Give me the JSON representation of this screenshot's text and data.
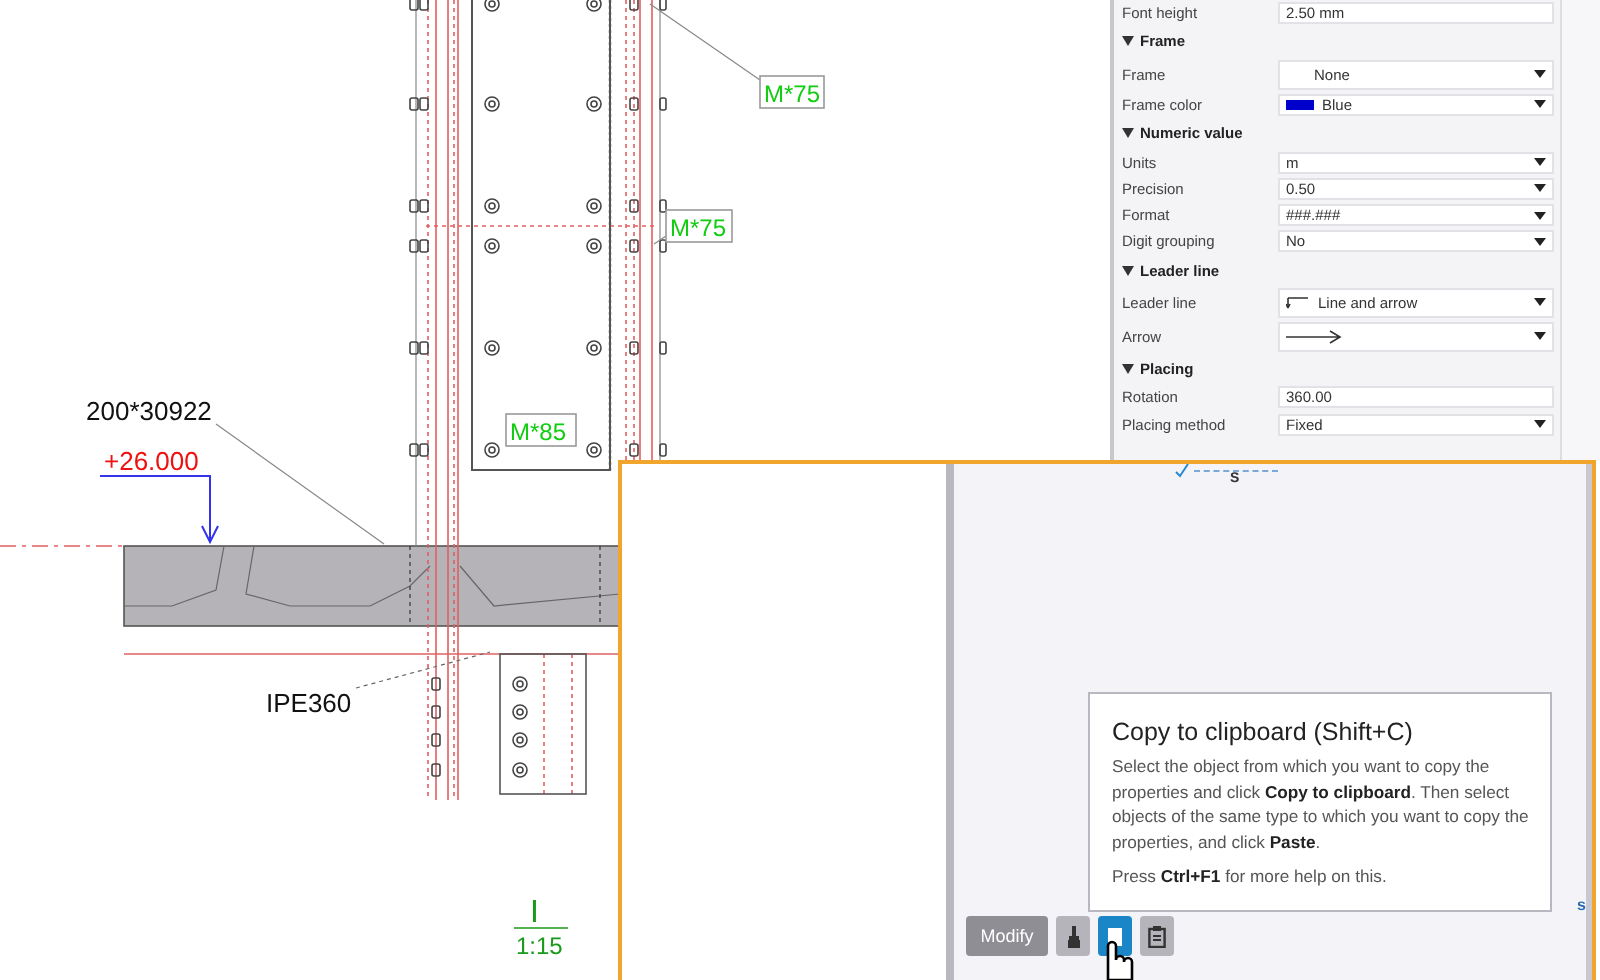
{
  "drawing": {
    "bolt_tags": [
      "M*75",
      "M*75",
      "M*85"
    ],
    "plate_label": "200*30922",
    "elevation": "+26.000",
    "profile_label": "IPE360",
    "detail_mark": "I",
    "scale": "1:15"
  },
  "properties": {
    "top_rows": [
      {
        "label": "Font height",
        "value": "2.50 mm",
        "kind": "input"
      }
    ],
    "sections": [
      {
        "title": "Frame",
        "expanded": true,
        "rows": [
          {
            "label": "Frame",
            "value": "None",
            "kind": "dropdown"
          },
          {
            "label": "Frame color",
            "value": "Blue",
            "kind": "color",
            "color": "#0000cc"
          }
        ]
      },
      {
        "title": "Numeric value",
        "expanded": true,
        "rows": [
          {
            "label": "Units",
            "value": "m",
            "kind": "dropdown"
          },
          {
            "label": "Precision",
            "value": "0.50",
            "kind": "dropdown"
          },
          {
            "label": "Format",
            "value": "###.###",
            "kind": "dropdown"
          },
          {
            "label": "Digit grouping",
            "value": "No",
            "kind": "dropdown"
          }
        ]
      },
      {
        "title": "Leader line",
        "expanded": true,
        "rows": [
          {
            "label": "Leader line",
            "value": "Line and arrow",
            "kind": "leader"
          },
          {
            "label": "Arrow",
            "kind": "arrow"
          }
        ]
      },
      {
        "title": "Placing",
        "expanded": true,
        "rows": [
          {
            "label": "Rotation",
            "value": "360.00",
            "kind": "input"
          },
          {
            "label": "Placing method",
            "value": "Fixed",
            "kind": "dropdown"
          }
        ]
      }
    ]
  },
  "panel": {
    "marker": "S",
    "edge_marker": "s",
    "tooltip": {
      "title": "Copy to clipboard (Shift+C)",
      "paragraphs": [
        "Select the object from which you want to copy the properties and click **Copy to clipboard**. Then select objects of the same type to which you want to copy the properties, and click **Paste**.",
        "Press **Ctrl+F1** for more help on this."
      ]
    },
    "toolbar": [
      {
        "kind": "text",
        "label": "Modify",
        "disabled": true,
        "selected": false
      },
      {
        "kind": "brush",
        "disabled": false,
        "selected": false
      },
      {
        "kind": "copy",
        "disabled": false,
        "selected": true
      },
      {
        "kind": "paste",
        "disabled": false,
        "selected": false
      }
    ]
  }
}
